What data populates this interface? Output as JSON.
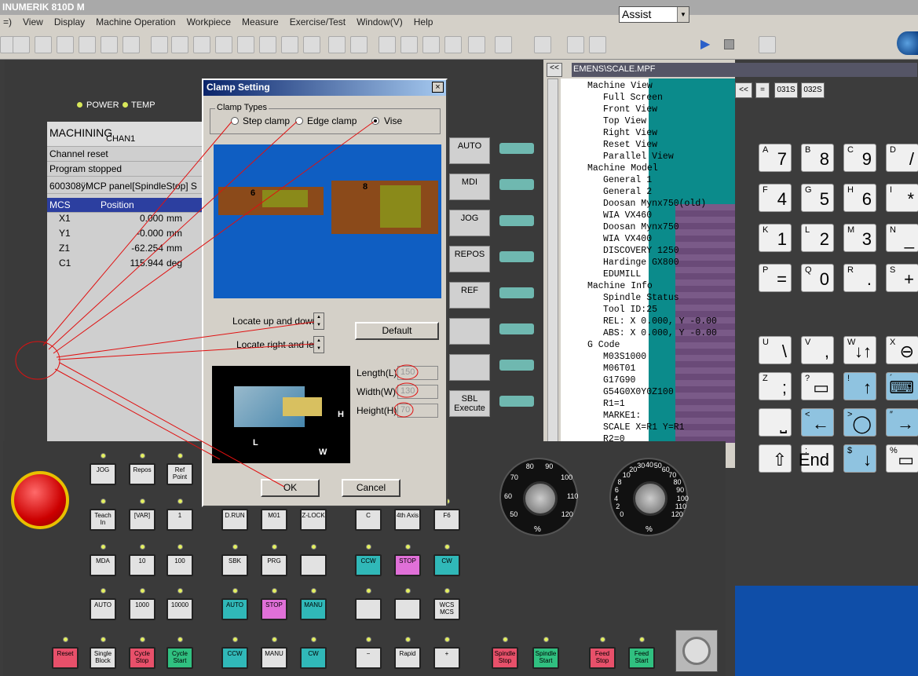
{
  "window": {
    "title": "INUMERIK 810D M"
  },
  "menu": [
    "=)",
    "View",
    "Display",
    "Machine Operation",
    "Workpiece",
    "Measure",
    "Exercise/Test",
    "Window(V)",
    "Help"
  ],
  "toolbar": {
    "mode_select": "Assist"
  },
  "hmi": {
    "power_label": "POWER",
    "temp_label": "TEMP",
    "machining": "MACHINING",
    "channel": "CHAN1",
    "channel_reset": "Channel reset",
    "program_stopped": "Program stopped",
    "alarm": "600308ÿMCP panel[SpindleStop] S",
    "mcs_header": "MCS",
    "position_header": "Position",
    "axes": [
      {
        "name": "X1",
        "value": "0.000",
        "unit": "mm"
      },
      {
        "name": "Y1",
        "value": "-0.000",
        "unit": "mm"
      },
      {
        "name": "Z1",
        "value": "-62.254",
        "unit": "mm"
      },
      {
        "name": "C1",
        "value": "115.944",
        "unit": "deg"
      }
    ],
    "softkeys": [
      "AUTO",
      "MDI",
      "JOG",
      "REPOS",
      "REF",
      "",
      "",
      "SBL\nExecute"
    ]
  },
  "right": {
    "prev": "<<",
    "path": "EMENS\\SCALE.MPF",
    "tree": [
      "Machine View",
      "Full Screen",
      "Front View",
      "Top View",
      "Right View",
      "Reset View",
      "Parallel View",
      "Machine Model",
      "General 1",
      "General 2",
      "Doosan Mynx750(old)",
      "WIA VX460",
      "Doosan Mynx750",
      "WIA VX400",
      "DISCOVERY 1250",
      "Hardinge GX800",
      "EDUMILL",
      "Machine Info",
      "Spindle Status",
      "Tool ID:25",
      "REL: X   0.000, Y  -0.00",
      "ABS: X   0.000, Y  -0.00",
      "G Code",
      "M03S1000",
      "M06T01",
      "G17G90",
      "G54G0X0Y0Z100",
      "R1=1",
      "MARKE1:",
      "SCALE X=R1 Y=R1",
      "R2=0"
    ],
    "small_buttons": [
      "<<",
      "=",
      "031S",
      "032S"
    ]
  },
  "keypad": [
    {
      "s": "A",
      "b": "7"
    },
    {
      "s": "B",
      "b": "8"
    },
    {
      "s": "C",
      "b": "9"
    },
    {
      "s": "D",
      "b": "/"
    },
    {
      "s": "F",
      "b": "4"
    },
    {
      "s": "G",
      "b": "5"
    },
    {
      "s": "H",
      "b": "6"
    },
    {
      "s": "I",
      "b": "*"
    },
    {
      "s": "K",
      "b": "1"
    },
    {
      "s": "L",
      "b": "2"
    },
    {
      "s": "M",
      "b": "3"
    },
    {
      "s": "N",
      "b": "_"
    },
    {
      "s": "P",
      "b": "="
    },
    {
      "s": "Q",
      "b": "0"
    },
    {
      "s": "R",
      "b": "."
    },
    {
      "s": "S",
      "b": "+"
    },
    {
      "s": "U",
      "b": "\\"
    },
    {
      "s": "V",
      "b": ","
    },
    {
      "s": "W",
      "b": "↓↑"
    },
    {
      "s": "X",
      "b": "⊖"
    },
    {
      "s": "Z",
      "b": ";"
    },
    {
      "s": "?",
      "b": "▭"
    },
    {
      "s": "!",
      "b": "↑"
    },
    {
      "s": "´",
      "b": "⌨"
    },
    {
      "s": "",
      "b": "⎵"
    },
    {
      "s": "<",
      "b": "←"
    },
    {
      "s": ">",
      "b": "◯"
    },
    {
      "s": "″",
      "b": "→"
    },
    {
      "s": "",
      "b": "⇧"
    },
    {
      "s": ":",
      "b": "End"
    },
    {
      "s": "$",
      "b": "↓"
    },
    {
      "s": "%",
      "b": "▭"
    }
  ],
  "mcp": {
    "buttons": [
      "JOG",
      "Repos",
      "Ref Point",
      "Teach In",
      "[VAR]",
      "1",
      "D.RUN",
      "M01",
      "Z-LOCK",
      "C",
      "4th Axis",
      "F6",
      "MDA",
      "10",
      "100",
      "SBK",
      "PRG",
      "",
      "CCW",
      "STOP",
      "CW",
      "AUTO",
      "1000",
      "10000",
      "AUTO",
      "STOP",
      "MANU",
      "",
      "",
      "WCS MCS",
      "Reset",
      "Single Block",
      "Cycle Stop",
      "Cycle Start",
      "CCW",
      "MANU",
      "CW",
      "−",
      "Rapid",
      "+",
      "Spindle Stop",
      "Spindle Start",
      "Feed Stop",
      "Feed Start"
    ],
    "spindle_dial": {
      "ticks": [
        "50",
        "60",
        "70",
        "80",
        "90",
        "100",
        "110",
        "120"
      ],
      "unit": "%"
    },
    "feed_dial": {
      "ticks": [
        "0",
        "2",
        "4",
        "6",
        "8",
        "10",
        "20",
        "30",
        "40",
        "50",
        "60",
        "70",
        "80",
        "90",
        "100",
        "110",
        "120"
      ],
      "unit": "%"
    }
  },
  "dialog": {
    "title": "Clamp Setting",
    "group": "Clamp Types",
    "options": [
      "Step clamp",
      "Edge clamp",
      "Vise"
    ],
    "selected": "Vise",
    "locate_ud": "Locate up and down",
    "locate_rl": "Locate right and left",
    "default_btn": "Default",
    "length_label": "Length(L)",
    "length_value": "150",
    "width_label": "Width(W)",
    "width_value": "130",
    "height_label": "Height(H)",
    "height_value": "70",
    "ok": "OK",
    "cancel": "Cancel",
    "preview_labels": [
      "6",
      "8"
    ],
    "vise_dims": [
      "H",
      "L",
      "W"
    ]
  },
  "colors": {
    "accent": "#0a246a",
    "annotation": "#e01010",
    "preview_bg": "#0f5ec2"
  }
}
